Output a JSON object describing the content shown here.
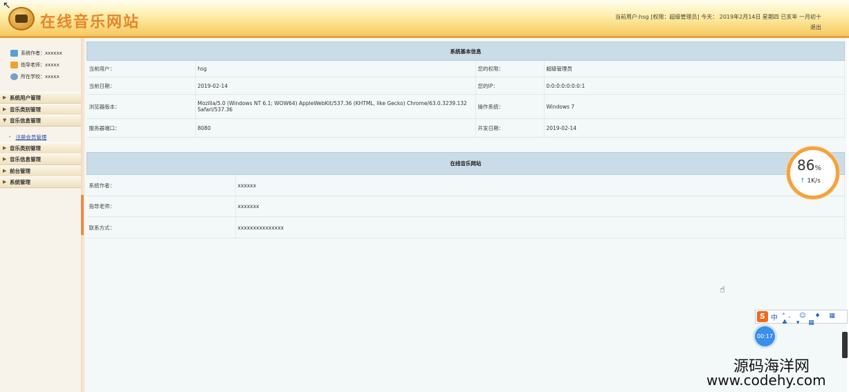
{
  "header": {
    "site_title": "在线音乐网站",
    "user_line": "当前用户:hsg [权限：超级管理员] 今天：  2019年2月14日 星期四 已亥年 一月初十",
    "logout": "退出"
  },
  "sidebar": {
    "info": [
      {
        "label": "系统作者：xxxxxx"
      },
      {
        "label": "指导老师：xxxxx"
      },
      {
        "label": "所在学校：xxxxx"
      }
    ],
    "menu": [
      {
        "label": "系统用户管理"
      },
      {
        "label": "音乐类别管理"
      },
      {
        "label": "音乐信息管理"
      }
    ],
    "sub_items": [
      {
        "label": "注册会员管理"
      }
    ],
    "menu2": [
      {
        "label": "音乐类别管理"
      },
      {
        "label": "音乐信息管理"
      },
      {
        "label": "前台管理"
      },
      {
        "label": "系统管理"
      }
    ]
  },
  "system_info": {
    "title": "系统基本信息",
    "rows": [
      {
        "l1": "当前用户：",
        "v1": "hsg",
        "l2": "您的权限：",
        "v2": "超级管理员"
      },
      {
        "l1": "当前日期：",
        "v1": "2019-02-14",
        "l2": "您的IP：",
        "v2": "0:0:0:0:0:0:0:1"
      },
      {
        "l1": "浏览器版本：",
        "v1": "Mozilla/5.0 (Windows NT 6.1; WOW64) AppleWebKit/537.36 (KHTML, like Gecko) Chrome/63.0.3239.132 Safari/537.36",
        "l2": "操作系统：",
        "v2": "Windows 7"
      },
      {
        "l1": "服务器端口：",
        "v1": "8080",
        "l2": "开发日期：",
        "v2": "2019-02-14"
      }
    ]
  },
  "site_info": {
    "title": "在线音乐网站",
    "rows": [
      {
        "label": "系统作者：",
        "value": "xxxxxx"
      },
      {
        "label": "指导老师：",
        "value": "xxxxxxx"
      },
      {
        "label": "联系方式：",
        "value": "xxxxxxxxxxxxxxx"
      }
    ]
  },
  "overlay": {
    "gauge_pct": "86",
    "gauge_pct_unit": "%",
    "gauge_speed": "1K/s",
    "gauge_arrow": "↑",
    "ime_logo": "S",
    "ime_mode": "中",
    "ime_icons": "°, ☺ ♦ ▦ ♣ ▾ ▦",
    "timer": "00:17",
    "watermark_cn": "源码海洋网",
    "watermark_url": "www.codehy.com"
  }
}
